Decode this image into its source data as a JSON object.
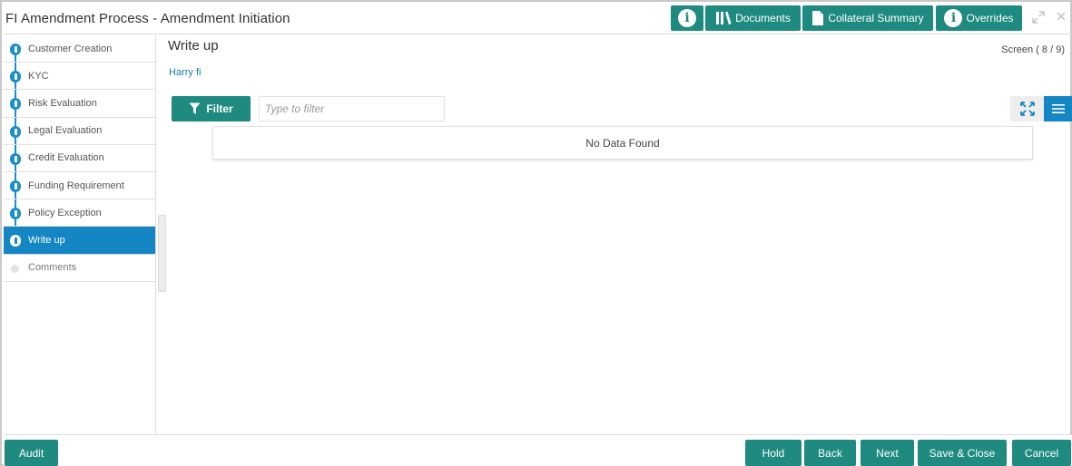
{
  "header": {
    "title": "FI Amendment Process - Amendment Initiation",
    "documents_label": "Documents",
    "collateral_label": "Collateral Summary",
    "overrides_label": "Overrides",
    "info_glyph": "i",
    "icons": [
      "info-icon",
      "library-icon",
      "document-icon",
      "info-icon",
      "maximize-icon",
      "close-icon"
    ]
  },
  "sidebar": {
    "steps": [
      {
        "label": "Customer Creation",
        "state": "done"
      },
      {
        "label": "KYC",
        "state": "done"
      },
      {
        "label": "Risk Evaluation",
        "state": "done"
      },
      {
        "label": "Legal Evaluation",
        "state": "done"
      },
      {
        "label": "Credit Evaluation",
        "state": "done"
      },
      {
        "label": "Funding Requirement",
        "state": "done"
      },
      {
        "label": "Policy Exception",
        "state": "done"
      },
      {
        "label": "Write up",
        "state": "active"
      },
      {
        "label": "Comments",
        "state": "pending"
      }
    ]
  },
  "main": {
    "title": "Write up",
    "screen_indicator": "Screen ( 8 / 9)",
    "subject": "Harry fi",
    "filter_label": "Filter",
    "filter_placeholder": "Type to filter",
    "empty_text": "No Data Found"
  },
  "footer": {
    "audit_label": "Audit",
    "hold_label": "Hold",
    "back_label": "Back",
    "next_label": "Next",
    "save_close_label": "Save & Close",
    "cancel_label": "Cancel"
  },
  "colors": {
    "primary_teal": "#1e8a80",
    "active_blue": "#1486c4",
    "step_blue": "#1b8fc9",
    "link_blue": "#1a77b8"
  }
}
